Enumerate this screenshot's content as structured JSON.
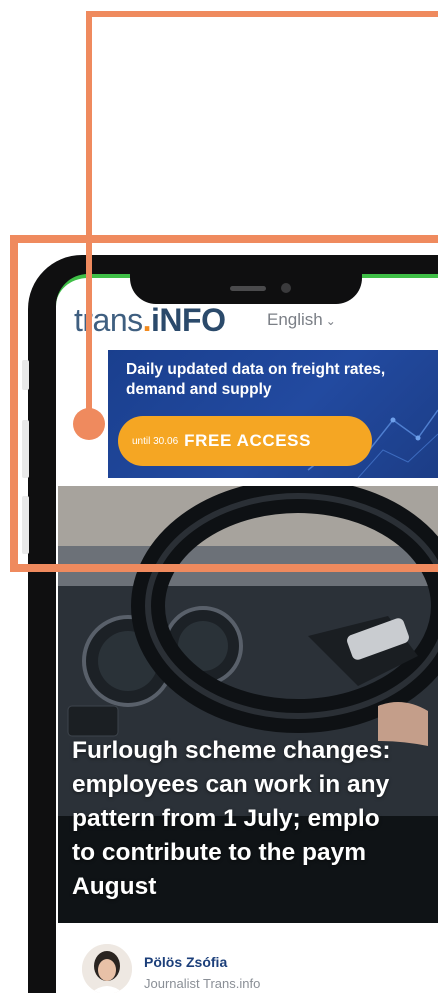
{
  "header": {
    "logo_part1": "trans",
    "logo_dot": ".",
    "logo_part2": "iNFO",
    "language": "English",
    "language_chevron": "⌄"
  },
  "banner": {
    "headline": "Daily updated data on freight rates, demand and supply",
    "cta_until": "until 30.06",
    "cta_label": "FREE ACCESS"
  },
  "article": {
    "headline": "Furlough scheme changes:\nemployees can work in any\npattern from 1 July; emplo\nto contribute to the paym\nAugust"
  },
  "author": {
    "name": "Pölös Zsófia",
    "role": "Journalist Trans.info"
  },
  "colors": {
    "accent_orange": "#ef8a5e",
    "brand_blue": "#2b4a6b",
    "banner_blue": "#224aa0",
    "cta_orange": "#f5a623"
  }
}
